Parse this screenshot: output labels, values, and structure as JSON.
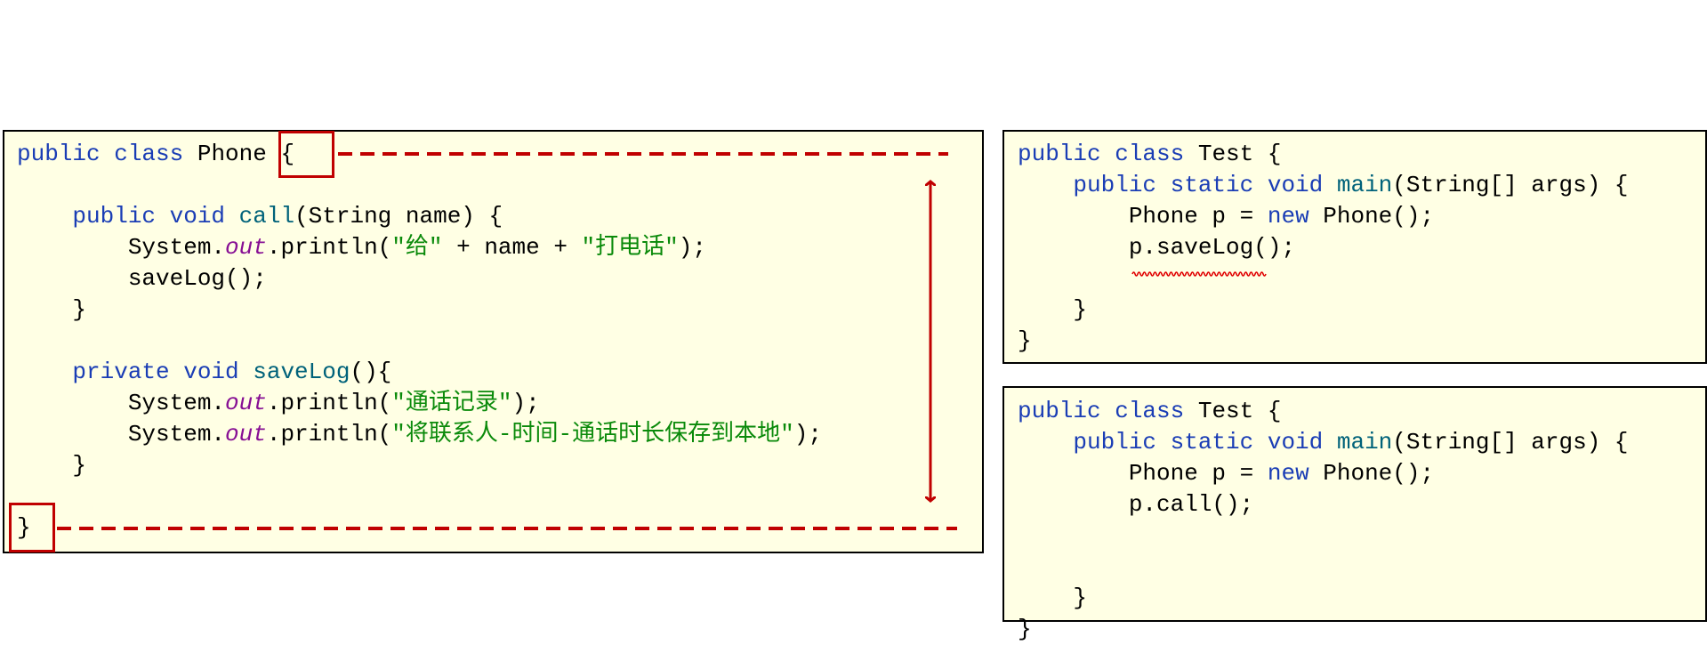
{
  "colors": {
    "keyword": "#1a3db5",
    "method": "#00627a",
    "string": "#0a8a0a",
    "field": "#871094",
    "annotation": "#c00000",
    "background": "#ffffe4"
  },
  "phone_class": {
    "lines": [
      [
        {
          "t": "public class ",
          "c": "kw"
        },
        {
          "t": "Phone ",
          "c": ""
        },
        {
          "t": "{",
          "c": ""
        }
      ],
      [],
      [
        {
          "t": "    public void ",
          "c": "kw"
        },
        {
          "t": "call",
          "c": "fn"
        },
        {
          "t": "(String name) {",
          "c": ""
        }
      ],
      [
        {
          "t": "        System.",
          "c": ""
        },
        {
          "t": "out",
          "c": "fld"
        },
        {
          "t": ".println(",
          "c": ""
        },
        {
          "t": "\"给\"",
          "c": "st"
        },
        {
          "t": " + name + ",
          "c": ""
        },
        {
          "t": "\"打电话\"",
          "c": "st"
        },
        {
          "t": ");",
          "c": ""
        }
      ],
      [
        {
          "t": "        saveLog();",
          "c": ""
        }
      ],
      [
        {
          "t": "    }",
          "c": ""
        }
      ],
      [],
      [
        {
          "t": "    private void ",
          "c": "kw"
        },
        {
          "t": "saveLog",
          "c": "fn"
        },
        {
          "t": "(){",
          "c": ""
        }
      ],
      [
        {
          "t": "        System.",
          "c": ""
        },
        {
          "t": "out",
          "c": "fld"
        },
        {
          "t": ".println(",
          "c": ""
        },
        {
          "t": "\"通话记录\"",
          "c": "st"
        },
        {
          "t": ");",
          "c": ""
        }
      ],
      [
        {
          "t": "        System.",
          "c": ""
        },
        {
          "t": "out",
          "c": "fld"
        },
        {
          "t": ".println(",
          "c": ""
        },
        {
          "t": "\"将联系人-时间-通话时长保存到本地\"",
          "c": "st"
        },
        {
          "t": ");",
          "c": ""
        }
      ],
      [
        {
          "t": "    }",
          "c": ""
        }
      ],
      [],
      [
        {
          "t": "}",
          "c": ""
        }
      ]
    ]
  },
  "test_savelog": {
    "lines": [
      [
        {
          "t": "public class ",
          "c": "kw"
        },
        {
          "t": "Test {",
          "c": ""
        }
      ],
      [
        {
          "t": "    public static void ",
          "c": "kw"
        },
        {
          "t": "main",
          "c": "fn"
        },
        {
          "t": "(String[] args) {",
          "c": ""
        }
      ],
      [
        {
          "t": "        Phone p = ",
          "c": ""
        },
        {
          "t": "new",
          "c": "kw"
        },
        {
          "t": " Phone();",
          "c": ""
        }
      ],
      [
        {
          "t": "        p.saveLog();",
          "c": ""
        }
      ],
      [],
      [
        {
          "t": "    }",
          "c": ""
        }
      ],
      [
        {
          "t": "}",
          "c": ""
        }
      ]
    ],
    "error_underline": "saveLog()"
  },
  "test_call": {
    "lines": [
      [
        {
          "t": "public class ",
          "c": "kw"
        },
        {
          "t": "Test {",
          "c": ""
        }
      ],
      [
        {
          "t": "    public static void ",
          "c": "kw"
        },
        {
          "t": "main",
          "c": "fn"
        },
        {
          "t": "(String[] args) {",
          "c": ""
        }
      ],
      [
        {
          "t": "        Phone p = ",
          "c": ""
        },
        {
          "t": "new",
          "c": "kw"
        },
        {
          "t": " Phone();",
          "c": ""
        }
      ],
      [
        {
          "t": "        p.call();",
          "c": ""
        }
      ],
      [],
      [],
      [
        {
          "t": "    }",
          "c": ""
        }
      ],
      [
        {
          "t": "}",
          "c": ""
        }
      ]
    ]
  }
}
